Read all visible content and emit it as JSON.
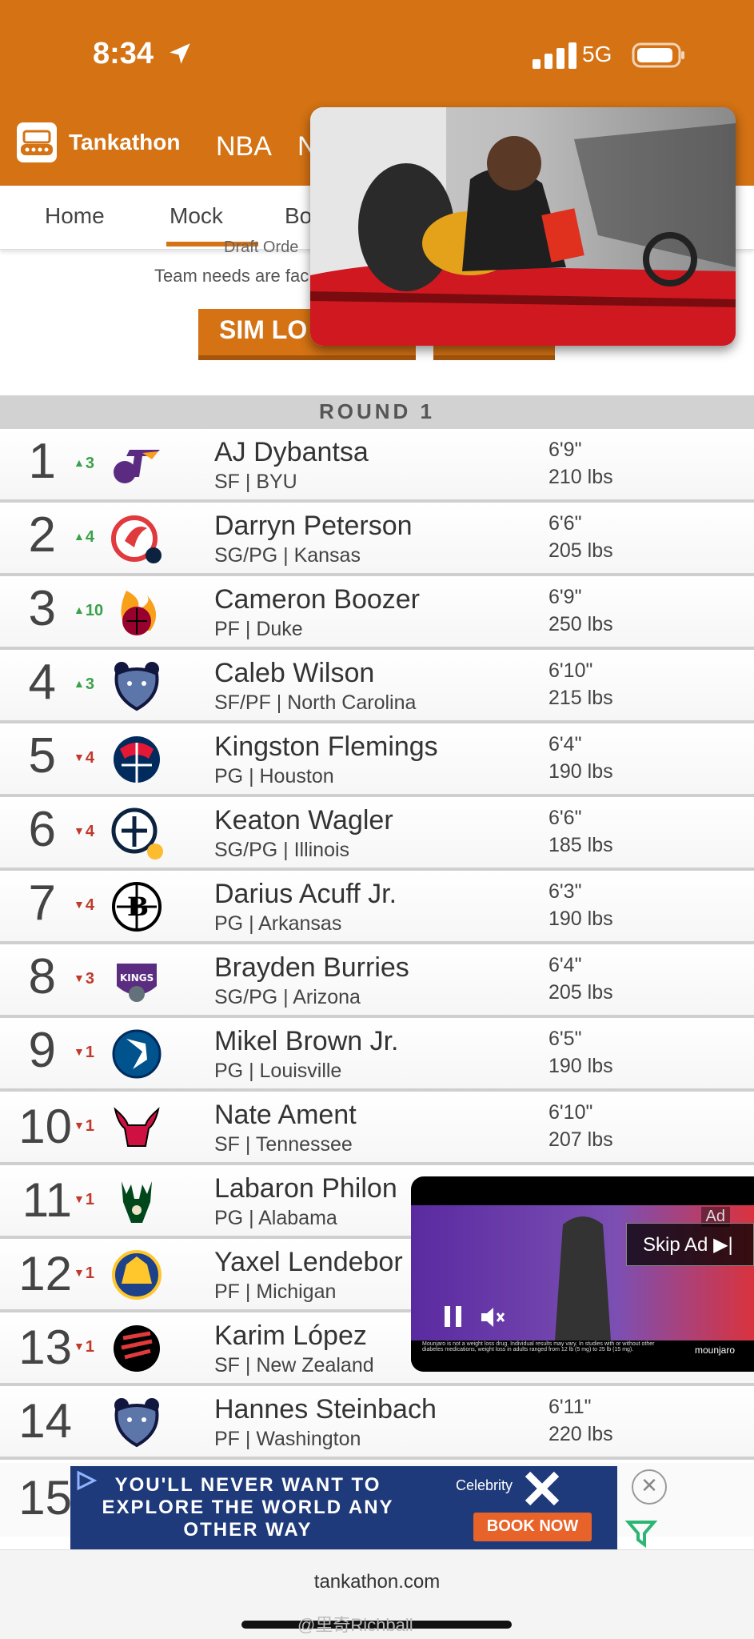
{
  "status": {
    "time": "8:34",
    "network": "5G"
  },
  "header": {
    "brand": "Tankathon",
    "league": "NBA",
    "league_cut": "N"
  },
  "tabs": [
    {
      "label": "Home"
    },
    {
      "label": "Mock"
    },
    {
      "label": "Bo"
    }
  ],
  "intro": {
    "line1": "Draft Orde",
    "line2": "Team needs are fac",
    "sim_label": "SIM LO"
  },
  "round_label": "ROUND 1",
  "picks": [
    {
      "pick": "1",
      "dir": "up",
      "change": "3",
      "team_icon": "jazz-logo-icon",
      "name": "AJ Dybantsa",
      "info": "SF | BYU",
      "height": "6'9\"",
      "weight": "210 lbs"
    },
    {
      "pick": "2",
      "dir": "up",
      "change": "4",
      "team_icon": "hawks-logo-icon",
      "name": "Darryn Peterson",
      "info": "SG/PG | Kansas",
      "height": "6'6\"",
      "weight": "205 lbs"
    },
    {
      "pick": "3",
      "dir": "up",
      "change": "10",
      "team_icon": "heat-logo-icon",
      "name": "Cameron Boozer",
      "info": "PF | Duke",
      "height": "6'9\"",
      "weight": "250 lbs"
    },
    {
      "pick": "4",
      "dir": "up",
      "change": "3",
      "team_icon": "grizzlies-logo-icon",
      "name": "Caleb Wilson",
      "info": "SF/PF | North Carolina",
      "height": "6'10\"",
      "weight": "215 lbs"
    },
    {
      "pick": "5",
      "dir": "down",
      "change": "4",
      "team_icon": "wizards-logo-icon",
      "name": "Kingston Flemings",
      "info": "PG | Houston",
      "height": "6'4\"",
      "weight": "190 lbs"
    },
    {
      "pick": "6",
      "dir": "down",
      "change": "4",
      "team_icon": "pelicans-logo-icon",
      "name": "Keaton Wagler",
      "info": "SG/PG | Illinois",
      "height": "6'6\"",
      "weight": "185 lbs"
    },
    {
      "pick": "7",
      "dir": "down",
      "change": "4",
      "team_icon": "nets-logo-icon",
      "name": "Darius Acuff Jr.",
      "info": "PG | Arkansas",
      "height": "6'3\"",
      "weight": "190 lbs"
    },
    {
      "pick": "8",
      "dir": "down",
      "change": "3",
      "team_icon": "kings-logo-icon",
      "name": "Brayden Burries",
      "info": "SG/PG | Arizona",
      "height": "6'4\"",
      "weight": "205 lbs"
    },
    {
      "pick": "9",
      "dir": "down",
      "change": "1",
      "team_icon": "mavericks-logo-icon",
      "name": "Mikel Brown Jr.",
      "info": "PG | Louisville",
      "height": "6'5\"",
      "weight": "190 lbs"
    },
    {
      "pick": "10",
      "dir": "down",
      "change": "1",
      "team_icon": "bulls-logo-icon",
      "name": "Nate Ament",
      "info": "SF | Tennessee",
      "height": "6'10\"",
      "weight": "207 lbs"
    },
    {
      "pick": "11",
      "dir": "down",
      "change": "1",
      "team_icon": "bucks-logo-icon",
      "name": "Labaron Philon",
      "info": "PG | Alabama",
      "height": "",
      "weight": ""
    },
    {
      "pick": "12",
      "dir": "down",
      "change": "1",
      "team_icon": "warriors-logo-icon",
      "name": "Yaxel Lendebor",
      "info": "PF | Michigan",
      "height": "",
      "weight": ""
    },
    {
      "pick": "13",
      "dir": "down",
      "change": "1",
      "team_icon": "blazers-logo-icon",
      "name": "Karim López",
      "info": "SF | New Zealand",
      "height": "",
      "weight": ""
    },
    {
      "pick": "14",
      "dir": "",
      "change": "",
      "team_icon": "grizzlies-logo-icon",
      "name": "Hannes Steinbach",
      "info": "PF | Washington",
      "height": "6'11\"",
      "weight": "220 lbs"
    }
  ],
  "pick15": {
    "pick": "15"
  },
  "video_ad": {
    "tag": "Ad",
    "skip": "Skip Ad",
    "brand": "mounjaro",
    "fineprint": "Mounjaro is not a weight loss drug. Individual results may vary. In studies with or without other diabetes medications, weight loss in adults ranged from 12 lb (5 mg) to 25 lb (15 mg)."
  },
  "banner_ad": {
    "text": "YOU'LL NEVER WANT TO EXPLORE THE WORLD ANY OTHER WAY",
    "brand": "Celebrity",
    "button": "BOOK NOW",
    "close": "✕"
  },
  "browser": {
    "url": "tankathon.com",
    "watermark": "@里奇Richball"
  },
  "colors": {
    "brand": "#d47214",
    "up": "#3aa14a",
    "down": "#c0392b"
  }
}
